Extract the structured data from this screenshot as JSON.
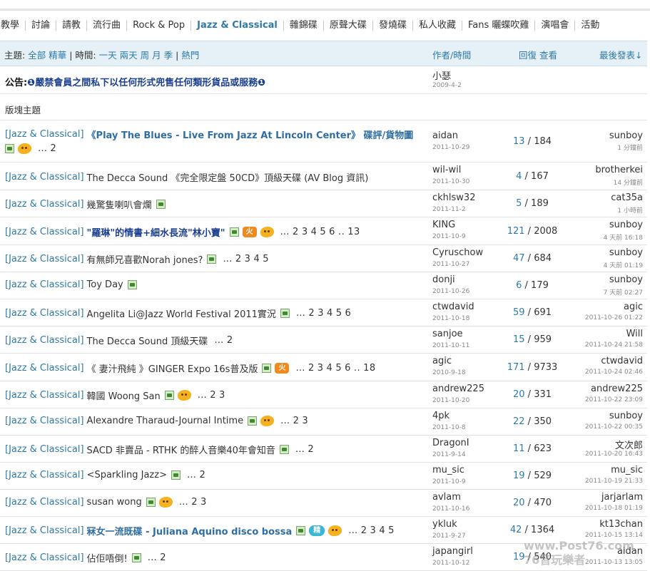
{
  "category_tabs": [
    {
      "label": "教學",
      "active": false
    },
    {
      "label": "討論",
      "active": false
    },
    {
      "label": "請教",
      "active": false
    },
    {
      "label": "流行曲",
      "active": false
    },
    {
      "label": "Rock & Pop",
      "active": false
    },
    {
      "label": "Jazz & Classical",
      "active": true
    },
    {
      "label": "雜錦碟",
      "active": false
    },
    {
      "label": "原聲大碟",
      "active": false
    },
    {
      "label": "發燒碟",
      "active": false
    },
    {
      "label": "私人收藏",
      "active": false
    },
    {
      "label": "Fans 曬蝶吹雞",
      "active": false
    },
    {
      "label": "演唱會",
      "active": false
    },
    {
      "label": "活動",
      "active": false
    }
  ],
  "list_header": {
    "topic_prefix": "主題:",
    "all": "全部",
    "digest": "精華",
    "time_sep": "| 時間:",
    "t_day": "一天",
    "t_2day": "兩天",
    "t_week": "周",
    "t_month": "月",
    "t_season": "季",
    "hot_sep": "|",
    "hot": "熱門",
    "author_time": "作者/時間",
    "replies_views": "回復 查看",
    "last_post": "最後發表↓"
  },
  "notice": {
    "prefix": "公告:",
    "text": "❶嚴禁會員之間私下以任何形式兜售任何類形貨品或服務❶",
    "author": "小瑟",
    "date": "2009-4-2"
  },
  "section_label": "版塊主題",
  "threads": [
    {
      "tag": "[Jazz & Classical]",
      "title": "《Play The Blues - Live From Jazz At Lincoln Center》 碟評/貨物圖",
      "bold": true,
      "icons": [
        "attach",
        "hot"
      ],
      "pages": [
        "…",
        "2"
      ],
      "author": "aidan",
      "date": "2011-10-29",
      "replies": "13",
      "views": "184",
      "last_user": "sunboy",
      "last_time": "1 分鐘前"
    },
    {
      "tag": "[Jazz & Classical]",
      "title": "The Decca Sound 《完全限定盤 50CD》頂級天碟 (AV Blog 資訊)",
      "bold": false,
      "icons": [],
      "pages": [],
      "author": "wil-wil",
      "date": "2011-10-30",
      "replies": "4",
      "views": "167",
      "last_user": "brotherkei",
      "last_time": "14 分鐘前"
    },
    {
      "tag": "[Jazz & Classical]",
      "title": "幾驚隻喇叭會爛",
      "bold": false,
      "icons": [
        "attach"
      ],
      "pages": [],
      "author": "ckhlsw32",
      "date": "2011-11-2",
      "replies": "5",
      "views": "189",
      "last_user": "cat35a",
      "last_time": "1 小時前"
    },
    {
      "tag": "[Jazz & Classical]",
      "title": "\"羅琳\"的情書+細水長流\"林小寶\"",
      "bold": true,
      "dark": true,
      "icons": [
        "attach",
        "fire",
        "hot"
      ],
      "pages": [
        "…",
        "2",
        "3",
        "4",
        "5",
        "6",
        "..",
        "13"
      ],
      "author": "KING",
      "date": "2011-10-9",
      "replies": "121",
      "views": "2008",
      "last_user": "sunboy",
      "last_time": "4 天前 16:18"
    },
    {
      "tag": "[Jazz & Classical]",
      "title": "有無師兄喜歡Norah jones?",
      "bold": false,
      "icons": [
        "attach"
      ],
      "pages": [
        "…",
        "2",
        "3",
        "4",
        "5"
      ],
      "author": "Cyruschow",
      "date": "2011-10-27",
      "replies": "47",
      "views": "684",
      "last_user": "sunboy",
      "last_time": "4 天前 01:19"
    },
    {
      "tag": "[Jazz & Classical]",
      "title": "Toy Day",
      "bold": false,
      "icons": [
        "attach"
      ],
      "pages": [],
      "author": "donji",
      "date": "2011-10-26",
      "replies": "6",
      "views": "179",
      "last_user": "sunboy",
      "last_time": "7 天前 02:27"
    },
    {
      "tag": "[Jazz & Classical]",
      "title": "Angelita Li@Jazz World Festival 2011實況",
      "bold": false,
      "icons": [
        "attach"
      ],
      "pages": [
        "…",
        "2",
        "3",
        "4",
        "5",
        "6"
      ],
      "author": "ctwdavid",
      "date": "2011-10-18",
      "replies": "59",
      "views": "691",
      "last_user": "agic",
      "last_time": "2011-10-26 01:22"
    },
    {
      "tag": "[Jazz & Classical]",
      "title": "The Decca Sound 頂級天碟",
      "bold": false,
      "icons": [],
      "pages": [
        "…",
        "2"
      ],
      "author": "sanjoe",
      "date": "2011-10-11",
      "replies": "15",
      "views": "959",
      "last_user": "Will",
      "last_time": "2011-10-24 21:58"
    },
    {
      "tag": "[Jazz & Classical]",
      "title": "《 妻汁飛純 》GINGER Expo 16s普及版",
      "bold": false,
      "icons": [
        "attach",
        "fire"
      ],
      "pages": [
        "…",
        "2",
        "3",
        "4",
        "5",
        "6",
        "..",
        "18"
      ],
      "author": "agic",
      "date": "2010-9-18",
      "replies": "171",
      "views": "9733",
      "last_user": "ctwdavid",
      "last_time": "2011-10-24 02:46"
    },
    {
      "tag": "[Jazz & Classical]",
      "title": "韓國 Woong San",
      "bold": false,
      "icons": [
        "attach",
        "hot"
      ],
      "pages": [
        "…",
        "2",
        "3"
      ],
      "author": "andrew225",
      "date": "2011-10-20",
      "replies": "20",
      "views": "331",
      "last_user": "andrew225",
      "last_time": "2011-10-22 23:09"
    },
    {
      "tag": "[Jazz & Classical]",
      "title": "Alexandre Tharaud-Journal Intime",
      "bold": false,
      "icons": [
        "attach",
        "hot"
      ],
      "pages": [
        "…",
        "2",
        "3"
      ],
      "author": "4pk",
      "date": "2011-10-8",
      "replies": "22",
      "views": "350",
      "last_user": "sunboy",
      "last_time": "2011-10-22 00:35"
    },
    {
      "tag": "[Jazz & Classical]",
      "title": "SACD 非賣品 - RTHK 的醉人音樂40年會知音",
      "bold": false,
      "icons": [
        "attach"
      ],
      "pages": [
        "…",
        "2"
      ],
      "author": "DragonI",
      "date": "2011-9-14",
      "replies": "11",
      "views": "623",
      "last_user": "文次郎",
      "last_time": "2011-10-20 16:43"
    },
    {
      "tag": "[Jazz & Classical]",
      "title": "<Sparkling Jazz>",
      "bold": false,
      "icons": [
        "attach"
      ],
      "pages": [
        "…",
        "2"
      ],
      "author": "mu_sic",
      "date": "2011-10-9",
      "replies": "19",
      "views": "529",
      "last_user": "mu_sic",
      "last_time": "2011-10-19 21:33"
    },
    {
      "tag": "[Jazz & Classical]",
      "title": "susan wong",
      "bold": false,
      "icons": [
        "attach",
        "hot"
      ],
      "pages": [
        "…",
        "2",
        "3"
      ],
      "author": "avlam",
      "date": "2011-10-16",
      "replies": "20",
      "views": "470",
      "last_user": "jarjarlam",
      "last_time": "2011-10-18 01:19"
    },
    {
      "tag": "[Jazz & Classical]",
      "title": "冧女一流既碟 - Juliana Aquino disco bossa",
      "bold": true,
      "icons": [
        "attach",
        "sticker",
        "hot"
      ],
      "pages": [
        "…",
        "2",
        "3",
        "4",
        "5"
      ],
      "author": "ykluk",
      "date": "2011-9-27",
      "replies": "42",
      "views": "1364",
      "last_user": "kt13chan",
      "last_time": "2011-10-15 13:14"
    },
    {
      "tag": "[Jazz & Classical]",
      "title": "佔佢唔倒!",
      "bold": false,
      "icons": [
        "attach"
      ],
      "pages": [
        "…",
        "2"
      ],
      "author": "japangirl",
      "date": "2011-10-12",
      "replies": "19",
      "views": "540",
      "last_user": "aidan",
      "last_time": "2011-10-13 13:05"
    }
  ],
  "icon_labels": {
    "fire": "火",
    "sticker": "精"
  },
  "watermark": {
    "line1": "www.Post76.com",
    "line2": "76音玩樂者"
  },
  "colors": {
    "accent": "#2f7aa8",
    "header_bg": "#e6f0f7",
    "bold_title": "#2f6ea3"
  }
}
